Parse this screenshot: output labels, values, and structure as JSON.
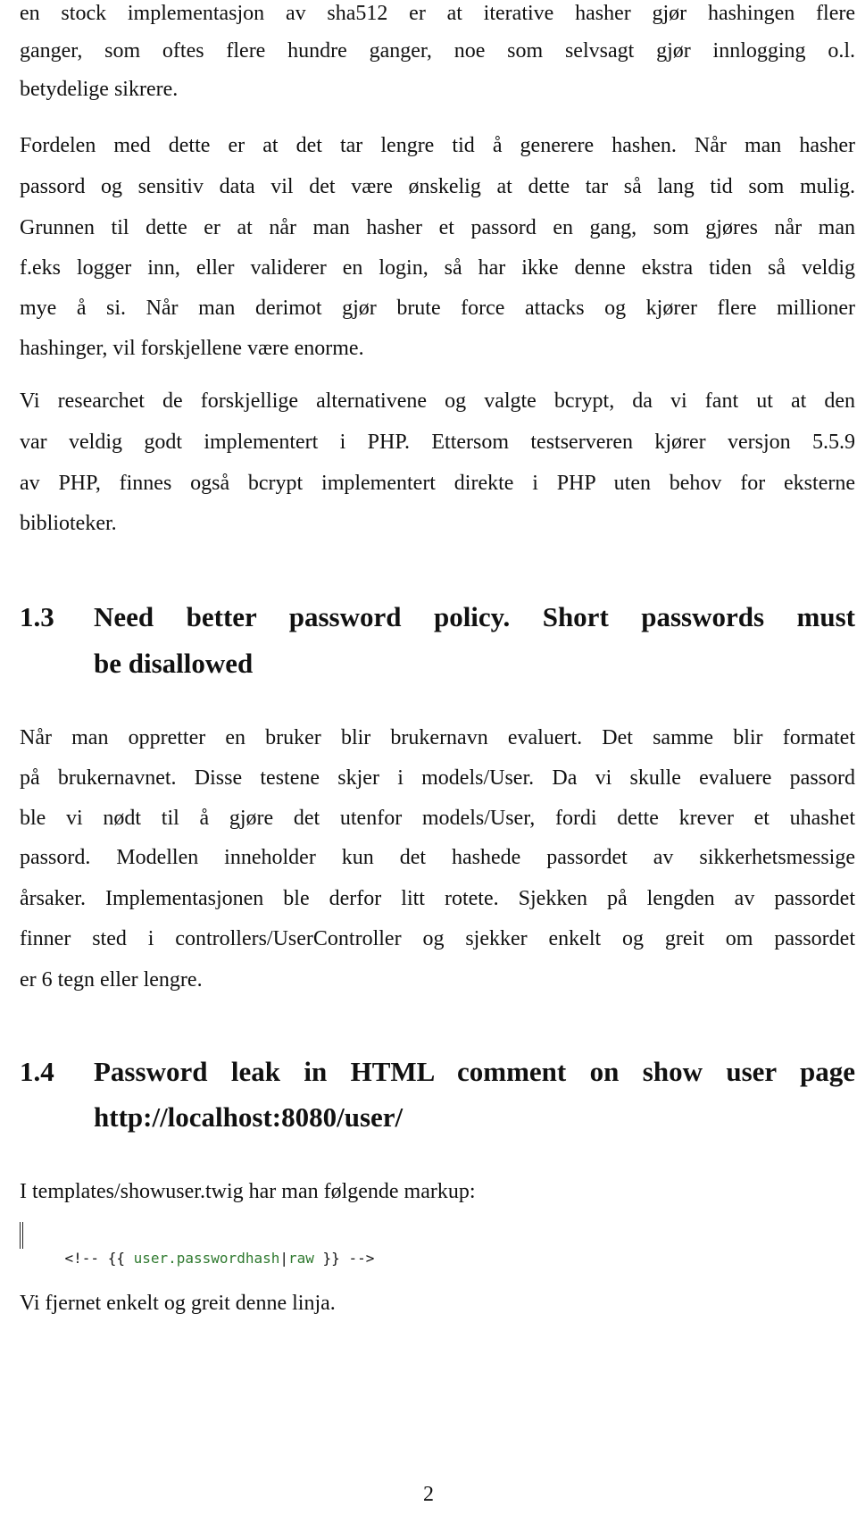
{
  "paragraph_1": {
    "lines": [
      "en stock implementasjon av sha512 er at iterative hasher gjør hashingen flere",
      "ganger, som oftes flere hundre ganger, noe som selvsagt gjør innlogging o.l.",
      "betydelige sikrere."
    ]
  },
  "paragraph_2": {
    "lines": [
      "Fordelen med dette er at det tar lengre tid å generere hashen. Når man hasher",
      "passord og sensitiv data vil det være ønskelig at dette tar så lang tid som mulig.",
      "Grunnen til dette er at når man hasher et passord en gang, som gjøres når man",
      "f.eks logger inn, eller validerer en login, så har ikke denne ekstra tiden så veldig",
      "mye å si. Når man derimot gjør brute force attacks og kjører flere millioner",
      "hashinger, vil forskjellene være enorme."
    ]
  },
  "paragraph_3": {
    "lines": [
      "Vi researchet de forskjellige alternativene og valgte bcrypt, da vi fant ut at den",
      "var veldig godt implementert i PHP. Ettersom testserveren kjører versjon 5.5.9",
      "av PHP, finnes også bcrypt implementert direkte i PHP uten behov for eksterne",
      "biblioteker."
    ]
  },
  "section_1_3": {
    "number": "1.3",
    "title_lines": [
      "Need better password policy. Short passwords must",
      "be disallowed"
    ],
    "lines": [
      "Når man oppretter en bruker blir brukernavn evaluert. Det samme blir formatet",
      "på brukernavnet. Disse testene skjer i models/User. Da vi skulle evaluere passord",
      "ble vi nødt til å gjøre det utenfor models/User, fordi dette krever et uhashet",
      "passord. Modellen inneholder kun det hashede passordet av sikkerhetsmessige",
      "årsaker. Implementasjonen ble derfor litt rotete. Sjekken på lengden av passordet",
      "finner sted i controllers/UserController og sjekker enkelt og greit om passordet",
      "er 6 tegn eller lengre."
    ]
  },
  "section_1_4": {
    "number": "1.4",
    "title_lines": [
      "Password leak in HTML comment on show user page",
      "http://localhost:8080/user/"
    ],
    "intro": "I templates/showuser.twig har man følgende markup:",
    "code": {
      "open": "<!-- {{ ",
      "var": "user.passwordhash",
      "pipe": "|",
      "filter": "raw",
      "close": " }} -->"
    },
    "outro": "Vi fjernet enkelt og greit denne linja."
  },
  "colors": {
    "code_keyword": "#2f7a2f"
  },
  "page_number": "2"
}
